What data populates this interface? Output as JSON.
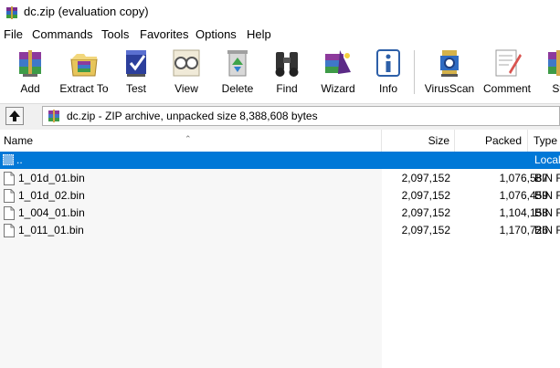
{
  "window": {
    "title": "dc.zip (evaluation copy)"
  },
  "menu": {
    "items": [
      "File",
      "Commands",
      "Tools",
      "Favorites",
      "Options",
      "Help"
    ]
  },
  "toolbar": {
    "buttons": [
      {
        "label": "Add",
        "icon": "add-archive-icon"
      },
      {
        "label": "Extract To",
        "icon": "extract-to-icon"
      },
      {
        "label": "Test",
        "icon": "test-icon"
      },
      {
        "label": "View",
        "icon": "view-icon"
      },
      {
        "label": "Delete",
        "icon": "delete-icon"
      },
      {
        "label": "Find",
        "icon": "find-binoculars-icon"
      },
      {
        "label": "Wizard",
        "icon": "wizard-icon"
      },
      {
        "label": "Info",
        "icon": "info-icon"
      },
      {
        "label": "VirusScan",
        "icon": "virusscan-icon"
      },
      {
        "label": "Comment",
        "icon": "comment-icon"
      },
      {
        "label": "Sf",
        "icon": "sfx-icon"
      }
    ]
  },
  "address": {
    "text": "dc.zip - ZIP archive, unpacked size 8,388,608 bytes",
    "up_icon": "up-folder-icon"
  },
  "columns": {
    "name": "Name",
    "size": "Size",
    "packed": "Packed",
    "type": "Type"
  },
  "parent_row": {
    "name": "..",
    "type": "Local"
  },
  "files": [
    {
      "name": "1_01d_01.bin",
      "size": "2,097,152",
      "packed": "1,076,587",
      "type": "BIN F"
    },
    {
      "name": "1_01d_02.bin",
      "size": "2,097,152",
      "packed": "1,076,459",
      "type": "BIN F"
    },
    {
      "name": "1_004_01.bin",
      "size": "2,097,152",
      "packed": "1,104,158",
      "type": "BIN F"
    },
    {
      "name": "1_011_01.bin",
      "size": "2,097,152",
      "packed": "1,170,726",
      "type": "BIN F"
    }
  ],
  "colors": {
    "selection": "#0078d7",
    "name_column_bg": "#f7f7f7"
  }
}
